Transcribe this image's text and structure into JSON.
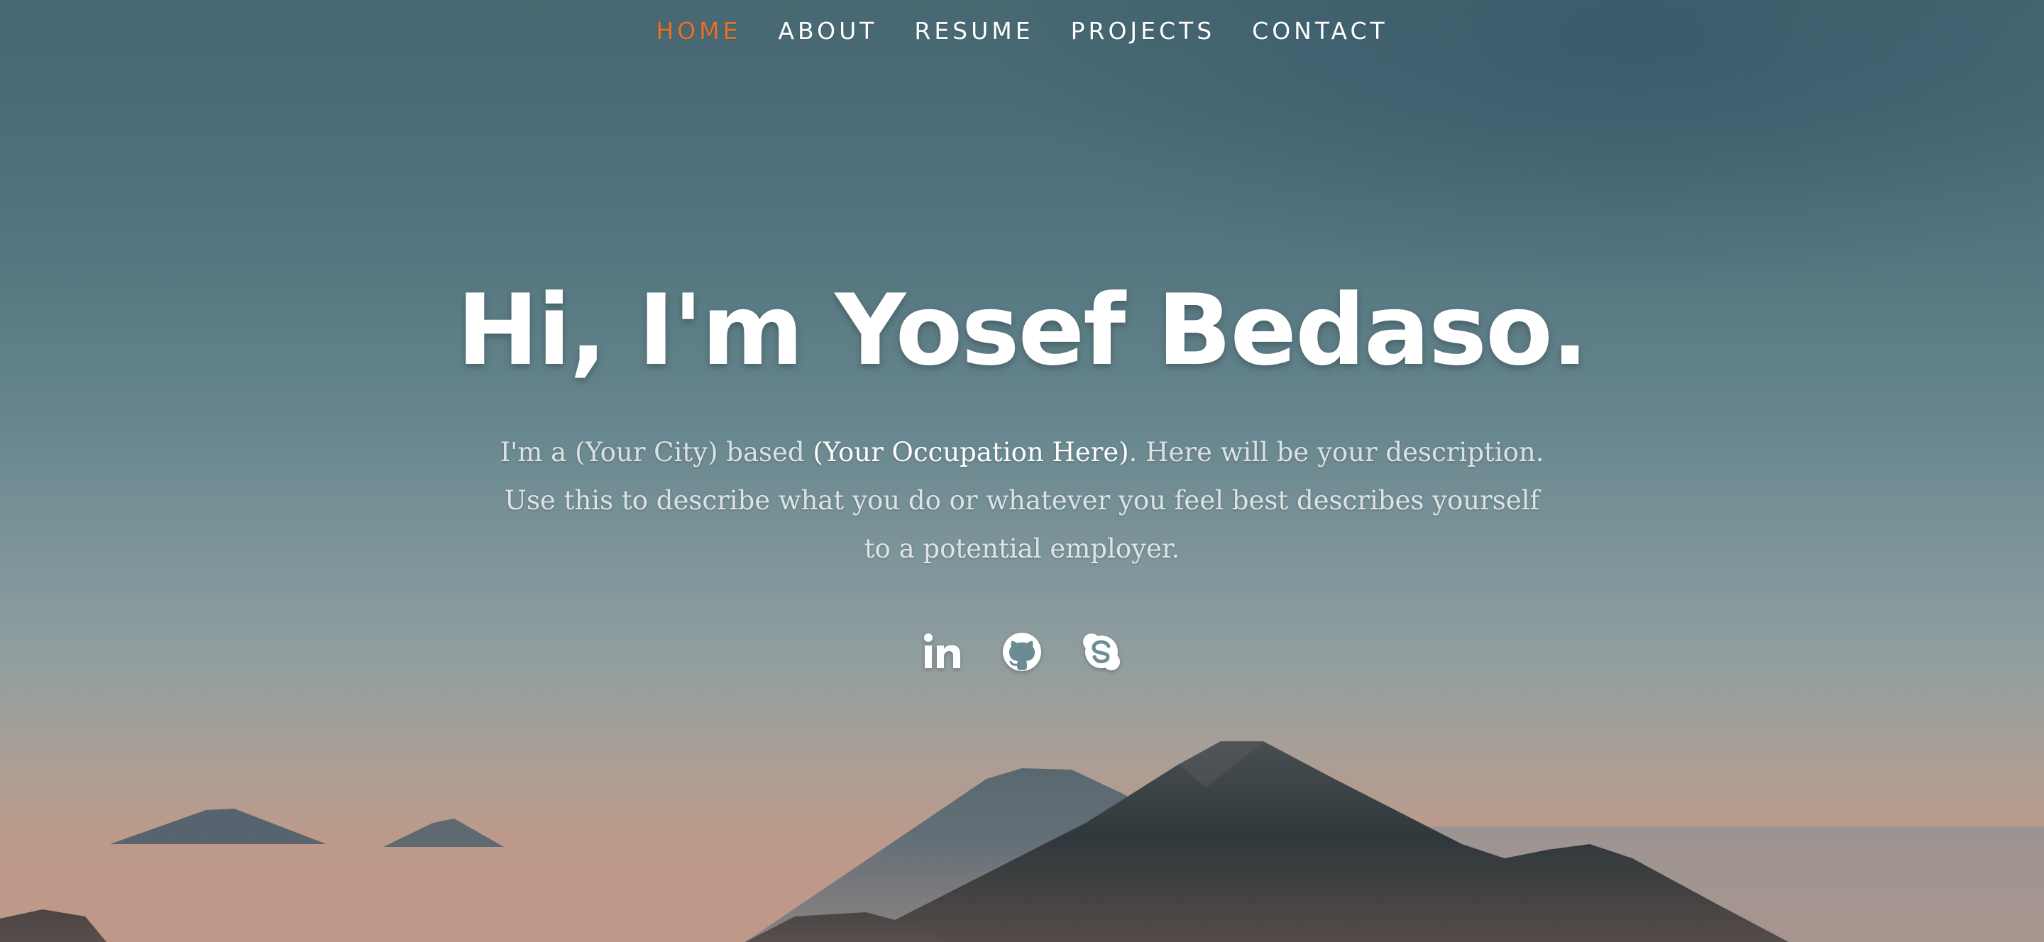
{
  "nav": {
    "items": [
      {
        "label": "HOME",
        "current": true
      },
      {
        "label": "ABOUT",
        "current": false
      },
      {
        "label": "RESUME",
        "current": false
      },
      {
        "label": "PROJECTS",
        "current": false
      },
      {
        "label": "CONTACT",
        "current": false
      }
    ]
  },
  "hero": {
    "headline": "Hi, I'm Yosef Bedaso.",
    "intro_before": "I'm a (Your City) based ",
    "intro_occupation": "(Your Occupation Here)",
    "intro_after": ". Here will be your description. Use this to describe what you do or whatever you feel best describes yourself to a potential employer."
  },
  "social": {
    "icons": [
      "linkedin-icon",
      "github-icon",
      "skype-icon"
    ]
  },
  "colors": {
    "accent": "#e8702a",
    "text": "#ffffff"
  }
}
